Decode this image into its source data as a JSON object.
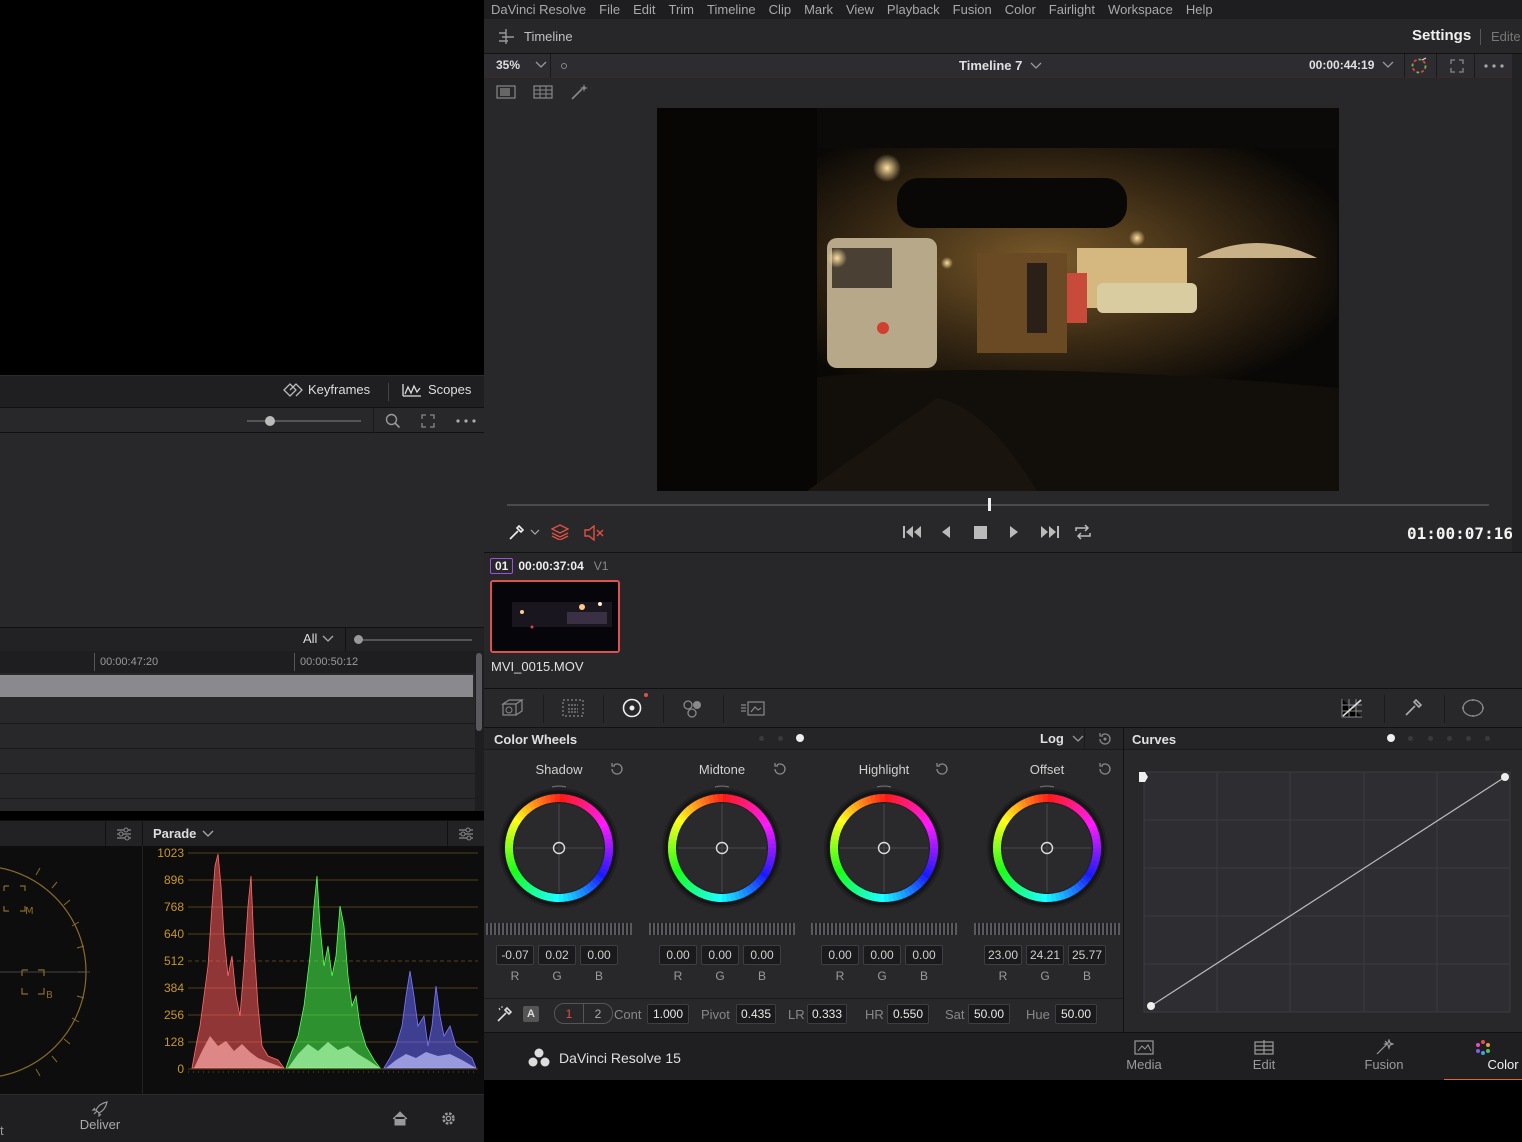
{
  "menubar": {
    "items": [
      "DaVinci Resolve",
      "File",
      "Edit",
      "Trim",
      "Timeline",
      "Clip",
      "Mark",
      "View",
      "Playback",
      "Fusion",
      "Color",
      "Fairlight",
      "Workspace",
      "Help"
    ]
  },
  "viewer": {
    "panel_title": "Timeline",
    "settings_label": "Settings",
    "edit_label": "Edite",
    "zoom": "35%",
    "timeline_name": "Timeline 7",
    "duration": "00:00:44:19",
    "timecode": "01:00:07:16",
    "playhead_fraction": 0.491
  },
  "left": {
    "keyframes_label": "Keyframes",
    "scopes_label": "Scopes",
    "filter_label": "All",
    "ruler_times": [
      "00:00:47:20",
      "00:00:50:12"
    ],
    "scope_type": "Parade",
    "scope_ticks": [
      "1023",
      "896",
      "768",
      "640",
      "512",
      "384",
      "256",
      "128",
      "0"
    ],
    "vectorscope_labels": [
      "M",
      "B"
    ],
    "deliver_label": "Deliver",
    "cut_label": "t"
  },
  "clips": {
    "clip_number": "01",
    "clip_timecode": "00:00:37:04",
    "track": "V1",
    "clip_name": "MVI_0015.MOV"
  },
  "color_wheels": {
    "title": "Color Wheels",
    "mode": "Log",
    "wheels": [
      {
        "name": "Shadow",
        "values": [
          "-0.07",
          "0.02",
          "0.00"
        ]
      },
      {
        "name": "Midtone",
        "values": [
          "0.00",
          "0.00",
          "0.00"
        ]
      },
      {
        "name": "Highlight",
        "values": [
          "0.00",
          "0.00",
          "0.00"
        ]
      },
      {
        "name": "Offset",
        "values": [
          "23.00",
          "24.21",
          "25.77"
        ]
      }
    ],
    "channel_labels": [
      "R",
      "G",
      "B"
    ],
    "auto_label": "A",
    "page_1": "1",
    "page_2": "2",
    "params": [
      {
        "label": "Cont",
        "value": "1.000"
      },
      {
        "label": "Pivot",
        "value": "0.435"
      },
      {
        "label": "LR",
        "value": "0.333"
      },
      {
        "label": "HR",
        "value": "0.550"
      },
      {
        "label": "Sat",
        "value": "50.00"
      },
      {
        "label": "Hue",
        "value": "50.00"
      }
    ]
  },
  "curves": {
    "title": "Curves"
  },
  "pages": {
    "app_name": "DaVinci Resolve 15",
    "items": [
      "Media",
      "Edit",
      "Fusion",
      "Color"
    ],
    "active": "Color"
  },
  "colors": {
    "accent_orange": "#e0643c",
    "active_red": "#e05050",
    "parade_red": "#ff5a5a",
    "parade_green": "#4aff4a",
    "parade_blue": "#6a6aff"
  }
}
